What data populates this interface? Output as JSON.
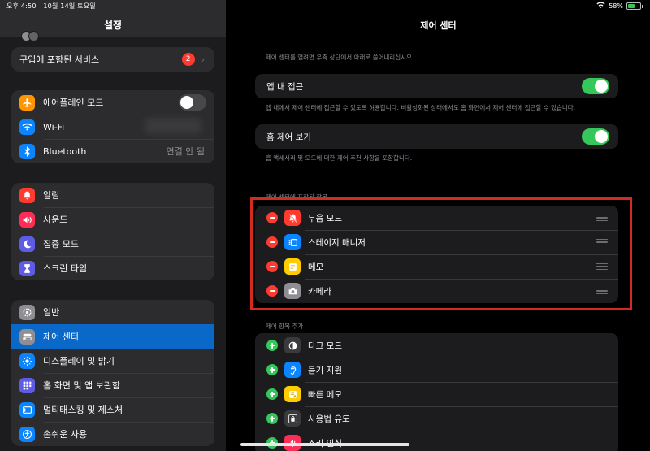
{
  "status_bar": {
    "time": "오후 4:50",
    "date": "10월 14일 토요일",
    "battery": "58%",
    "battery_level": 0.58
  },
  "sidebar": {
    "title": "설정",
    "purchase_row": {
      "label": "구입에 포함된 서비스",
      "badge": "2"
    },
    "connectivity": [
      {
        "label": "에어플레인 모드",
        "icon": "airplane-icon",
        "color": "#ff9500",
        "toggle": "off"
      },
      {
        "label": "Wi-Fi",
        "icon": "wifi-icon",
        "color": "#0a84ff"
      },
      {
        "label": "Bluetooth",
        "icon": "bluetooth-icon",
        "color": "#0a84ff",
        "value": "연결 안 됨"
      }
    ],
    "notifications": [
      {
        "label": "알림",
        "icon": "bell-icon",
        "color": "#ff3b30"
      },
      {
        "label": "사운드",
        "icon": "speaker-icon",
        "color": "#ff2d55"
      },
      {
        "label": "집중 모드",
        "icon": "moon-icon",
        "color": "#5e5ce6"
      },
      {
        "label": "스크린 타임",
        "icon": "hourglass-icon",
        "color": "#5e5ce6"
      }
    ],
    "general": [
      {
        "label": "일반",
        "icon": "gear-icon",
        "color": "#8e8e93"
      },
      {
        "label": "제어 센터",
        "icon": "switches-icon",
        "color": "#8e8e93",
        "selected": true
      },
      {
        "label": "디스플레이 및 밝기",
        "icon": "sun-icon",
        "color": "#0a84ff"
      },
      {
        "label": "홈 화면 및 앱 보관함",
        "icon": "apps-grid-icon",
        "color": "#5e5ce6"
      },
      {
        "label": "멀티태스킹 및 제스처",
        "icon": "multitask-icon",
        "color": "#0a84ff"
      },
      {
        "label": "손쉬운 사용",
        "icon": "accessibility-icon",
        "color": "#0a84ff"
      }
    ]
  },
  "main": {
    "title": "제어 센터",
    "intro_note": "제어 센터를 열려면 우측 상단에서 아래로 쓸어내리십시오.",
    "in_app_access": {
      "label": "앱 내 접근",
      "toggle": "on",
      "note": "앱 내에서 제어 센터에 접근할 수 있도록 허용합니다. 비활성화된 상태에서도 홈 화면에서 제어 센터에 접근할 수 있습니다."
    },
    "home_controls": {
      "label": "홈 제어 보기",
      "toggle": "on",
      "note": "홈 액세서리 및 모드에 대한 제어 추천 사항을 포함합니다."
    },
    "included_header": "제어 센터에 포함된 항목",
    "included": [
      {
        "label": "무음 모드",
        "icon": "bell-slash-icon",
        "color": "#ff3b30"
      },
      {
        "label": "스테이지 매니저",
        "icon": "stage-manager-icon",
        "color": "#0a84ff"
      },
      {
        "label": "메모",
        "icon": "notes-icon",
        "color": "#ffcc00"
      },
      {
        "label": "카메라",
        "icon": "camera-icon",
        "color": "#8e8e93"
      }
    ],
    "more_header": "제어 항목 추가",
    "more": [
      {
        "label": "다크 모드",
        "icon": "dark-mode-icon",
        "color": "#3a3a3c"
      },
      {
        "label": "듣기 지원",
        "icon": "ear-icon",
        "color": "#0a84ff"
      },
      {
        "label": "빠른 메모",
        "icon": "quick-note-icon",
        "color": "#ffcc00"
      },
      {
        "label": "사용법 유도",
        "icon": "lock-icon",
        "color": "#3a3a3c"
      },
      {
        "label": "소리 인식",
        "icon": "waveform-icon",
        "color": "#ff2d55"
      }
    ]
  }
}
